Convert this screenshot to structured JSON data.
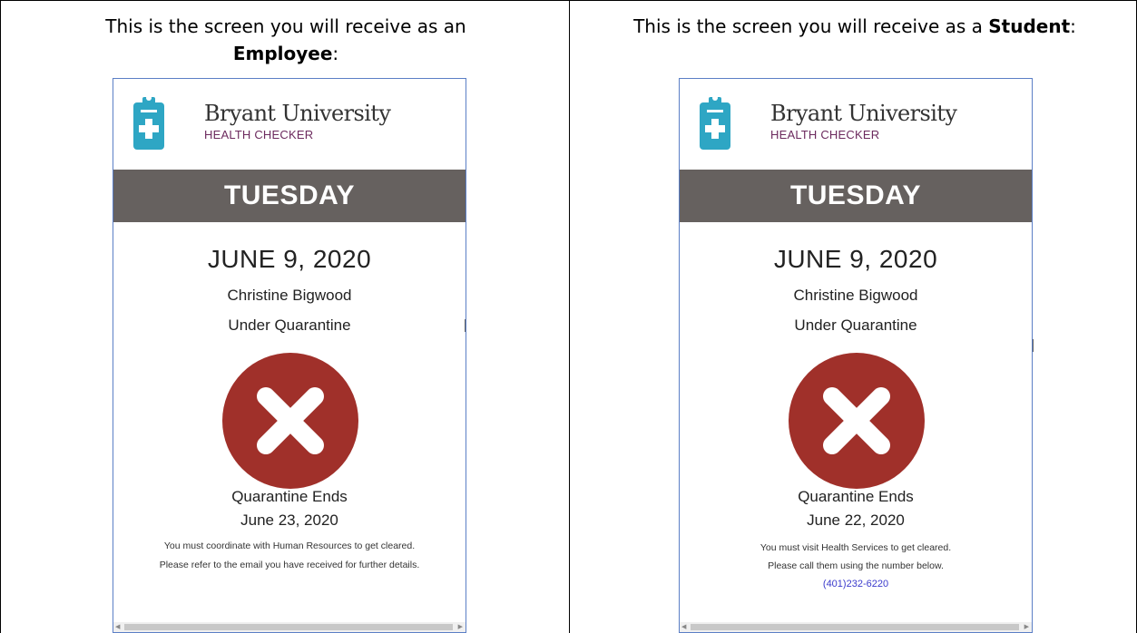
{
  "captions": {
    "left_text": "This is the screen you will receive as an ",
    "left_bold": "Employee",
    "left_end": ":",
    "right_text": "This is the screen you will receive as a ",
    "right_bold": "Student",
    "right_end": ":"
  },
  "app": {
    "brand_name": "Bryant University",
    "brand_sub": "HEALTH CHECKER",
    "accent_color": "#2ea6c4",
    "day_bar_color": "#66615f",
    "status_color": "#a0302a",
    "icon": "clipboard-plus-icon"
  },
  "employee": {
    "day": "TUESDAY",
    "date": "JUNE 9, 2020",
    "name": "Christine Bigwood",
    "status": "Under Quarantine",
    "status_icon": "x-circle-icon",
    "quarantine_label": "Quarantine Ends",
    "quarantine_date": "June 23, 2020",
    "note_1": "You must coordinate with Human Resources to get cleared.",
    "note_2": "Please refer to the email you have received for further details."
  },
  "student": {
    "day": "TUESDAY",
    "date": "JUNE 9, 2020",
    "name": "Christine Bigwood",
    "status": "Under Quarantine",
    "status_icon": "x-circle-icon",
    "quarantine_label": "Quarantine Ends",
    "quarantine_date": "June 22, 2020",
    "note_1": "You must visit Health Services to get cleared.",
    "note_2": "Please call them using the number below.",
    "phone": "(401)232-6220"
  }
}
